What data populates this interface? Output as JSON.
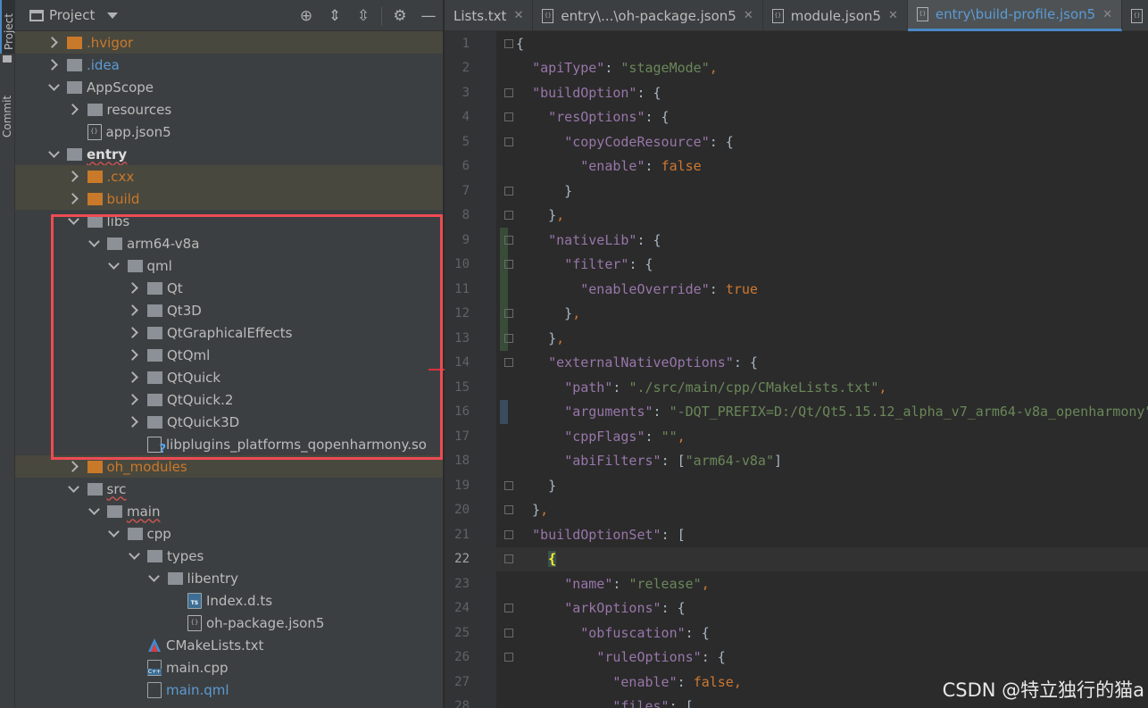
{
  "sidebar_strip": {
    "project_label": "Project",
    "commit_label": "Commit"
  },
  "project_panel": {
    "title": "Project",
    "tree": [
      {
        "label": ".hvigor",
        "icon": "folder-orange",
        "arrow": "collapsed",
        "indent": 0,
        "style": "orange",
        "excluded": true
      },
      {
        "label": ".idea",
        "icon": "folder",
        "arrow": "collapsed",
        "indent": 0,
        "style": "blue",
        "excluded": false
      },
      {
        "label": "AppScope",
        "icon": "folder",
        "arrow": "expanded",
        "indent": 0,
        "style": "",
        "excluded": false
      },
      {
        "label": "resources",
        "icon": "folder",
        "arrow": "collapsed",
        "indent": 1,
        "style": "",
        "excluded": false
      },
      {
        "label": "app.json5",
        "icon": "json-file",
        "arrow": "none",
        "indent": 1,
        "style": "",
        "excluded": false
      },
      {
        "label": "entry",
        "icon": "module-folder",
        "arrow": "expanded",
        "indent": 0,
        "style": "bold squiggle",
        "excluded": false
      },
      {
        "label": ".cxx",
        "icon": "folder-orange",
        "arrow": "collapsed",
        "indent": 1,
        "style": "orange",
        "excluded": true
      },
      {
        "label": "build",
        "icon": "folder-orange",
        "arrow": "collapsed",
        "indent": 1,
        "style": "orange",
        "excluded": true
      },
      {
        "label": "libs",
        "icon": "folder",
        "arrow": "expanded",
        "indent": 1,
        "style": "",
        "excluded": false
      },
      {
        "label": "arm64-v8a",
        "icon": "folder",
        "arrow": "expanded",
        "indent": 2,
        "style": "",
        "excluded": false
      },
      {
        "label": "qml",
        "icon": "folder",
        "arrow": "expanded",
        "indent": 3,
        "style": "",
        "excluded": false
      },
      {
        "label": "Qt",
        "icon": "folder",
        "arrow": "collapsed",
        "indent": 4,
        "style": "",
        "excluded": false
      },
      {
        "label": "Qt3D",
        "icon": "folder",
        "arrow": "collapsed",
        "indent": 4,
        "style": "",
        "excluded": false
      },
      {
        "label": "QtGraphicalEffects",
        "icon": "folder",
        "arrow": "collapsed",
        "indent": 4,
        "style": "",
        "excluded": false
      },
      {
        "label": "QtQml",
        "icon": "folder",
        "arrow": "collapsed",
        "indent": 4,
        "style": "",
        "excluded": false
      },
      {
        "label": "QtQuick",
        "icon": "folder",
        "arrow": "collapsed",
        "indent": 4,
        "style": "",
        "excluded": false
      },
      {
        "label": "QtQuick.2",
        "icon": "folder",
        "arrow": "collapsed",
        "indent": 4,
        "style": "",
        "excluded": false
      },
      {
        "label": "QtQuick3D",
        "icon": "folder",
        "arrow": "collapsed",
        "indent": 4,
        "style": "",
        "excluded": false
      },
      {
        "label": "libplugins_platforms_qopenharmony.so",
        "icon": "unknown-file",
        "arrow": "none",
        "indent": 4,
        "style": "",
        "excluded": false
      },
      {
        "label": "oh_modules",
        "icon": "folder-orange",
        "arrow": "collapsed",
        "indent": 1,
        "style": "orange",
        "excluded": true
      },
      {
        "label": "src",
        "icon": "folder",
        "arrow": "expanded",
        "indent": 1,
        "style": "squiggle",
        "excluded": false
      },
      {
        "label": "main",
        "icon": "folder",
        "arrow": "expanded",
        "indent": 2,
        "style": "squiggle",
        "excluded": false
      },
      {
        "label": "cpp",
        "icon": "folder",
        "arrow": "expanded",
        "indent": 3,
        "style": "",
        "excluded": false
      },
      {
        "label": "types",
        "icon": "folder",
        "arrow": "expanded",
        "indent": 4,
        "style": "",
        "excluded": false
      },
      {
        "label": "libentry",
        "icon": "folder",
        "arrow": "expanded",
        "indent": 5,
        "style": "",
        "excluded": false
      },
      {
        "label": "Index.d.ts",
        "icon": "ts-file",
        "arrow": "none",
        "indent": 6,
        "style": "",
        "excluded": false
      },
      {
        "label": "oh-package.json5",
        "icon": "json-file",
        "arrow": "none",
        "indent": 6,
        "style": "",
        "excluded": false
      },
      {
        "label": "CMakeLists.txt",
        "icon": "cmake-file",
        "arrow": "none",
        "indent": 4,
        "style": "",
        "excluded": false
      },
      {
        "label": "main.cpp",
        "icon": "cpp-file",
        "arrow": "none",
        "indent": 4,
        "style": "",
        "excluded": false
      },
      {
        "label": "main.qml",
        "icon": "qml-file",
        "arrow": "none",
        "indent": 4,
        "style": "blue",
        "excluded": false
      }
    ]
  },
  "editor": {
    "tabs": [
      {
        "label": "Lists.txt",
        "icon": false,
        "active": false
      },
      {
        "label": "entry\\...\\oh-package.json5",
        "icon": true,
        "active": false
      },
      {
        "label": "module.json5",
        "icon": true,
        "active": false
      },
      {
        "label": "entry\\build-profile.json5",
        "icon": true,
        "active": true
      },
      {
        "label": "b",
        "icon": true,
        "active": false
      }
    ],
    "current_line": 22,
    "lines": [
      {
        "n": 1,
        "tokens": [
          [
            "p",
            "{"
          ]
        ]
      },
      {
        "n": 2,
        "tokens": [
          [
            "p",
            "  "
          ],
          [
            "k",
            "\"apiType\""
          ],
          [
            "p",
            ": "
          ],
          [
            "s",
            "\"stageMode\""
          ],
          [
            "b",
            ","
          ]
        ]
      },
      {
        "n": 3,
        "tokens": [
          [
            "p",
            "  "
          ],
          [
            "k",
            "\"buildOption\""
          ],
          [
            "p",
            ": {"
          ]
        ]
      },
      {
        "n": 4,
        "tokens": [
          [
            "p",
            "    "
          ],
          [
            "k",
            "\"resOptions\""
          ],
          [
            "p",
            ": {"
          ]
        ]
      },
      {
        "n": 5,
        "tokens": [
          [
            "p",
            "      "
          ],
          [
            "k",
            "\"copyCodeResource\""
          ],
          [
            "p",
            ": {"
          ]
        ]
      },
      {
        "n": 6,
        "tokens": [
          [
            "p",
            "        "
          ],
          [
            "k",
            "\"enable\""
          ],
          [
            "p",
            ": "
          ],
          [
            "b",
            "false"
          ]
        ]
      },
      {
        "n": 7,
        "tokens": [
          [
            "p",
            "      }"
          ]
        ]
      },
      {
        "n": 8,
        "tokens": [
          [
            "p",
            "    }"
          ],
          [
            "b",
            ","
          ]
        ]
      },
      {
        "n": 9,
        "tokens": [
          [
            "p",
            "    "
          ],
          [
            "k",
            "\"nativeLib\""
          ],
          [
            "p",
            ": {"
          ]
        ]
      },
      {
        "n": 10,
        "tokens": [
          [
            "p",
            "      "
          ],
          [
            "k",
            "\"filter\""
          ],
          [
            "p",
            ": {"
          ]
        ]
      },
      {
        "n": 11,
        "tokens": [
          [
            "p",
            "        "
          ],
          [
            "k",
            "\"enableOverride\""
          ],
          [
            "p",
            ": "
          ],
          [
            "b",
            "true"
          ]
        ]
      },
      {
        "n": 12,
        "tokens": [
          [
            "p",
            "      }"
          ],
          [
            "b",
            ","
          ]
        ]
      },
      {
        "n": 13,
        "tokens": [
          [
            "p",
            "    }"
          ],
          [
            "b",
            ","
          ]
        ]
      },
      {
        "n": 14,
        "tokens": [
          [
            "p",
            "    "
          ],
          [
            "k",
            "\"externalNativeOptions\""
          ],
          [
            "p",
            ": {"
          ]
        ]
      },
      {
        "n": 15,
        "tokens": [
          [
            "p",
            "      "
          ],
          [
            "k",
            "\"path\""
          ],
          [
            "p",
            ": "
          ],
          [
            "s",
            "\"./src/main/cpp/CMakeLists.txt\""
          ],
          [
            "b",
            ","
          ]
        ]
      },
      {
        "n": 16,
        "tokens": [
          [
            "p",
            "      "
          ],
          [
            "k",
            "\"arguments\""
          ],
          [
            "p",
            ": "
          ],
          [
            "s",
            "\"-DQT_PREFIX=D:/Qt/Qt5.15.12_alpha_v7_arm64-v8a_openharmony\""
          ]
        ]
      },
      {
        "n": 17,
        "tokens": [
          [
            "p",
            "      "
          ],
          [
            "k",
            "\"cppFlags\""
          ],
          [
            "p",
            ": "
          ],
          [
            "s",
            "\"\""
          ],
          [
            "b",
            ","
          ]
        ]
      },
      {
        "n": 18,
        "tokens": [
          [
            "p",
            "      "
          ],
          [
            "k",
            "\"abiFilters\""
          ],
          [
            "p",
            ": ["
          ],
          [
            "s",
            "\"arm64-v8a\""
          ],
          [
            "p",
            "]"
          ]
        ]
      },
      {
        "n": 19,
        "tokens": [
          [
            "p",
            "    }"
          ]
        ]
      },
      {
        "n": 20,
        "tokens": [
          [
            "p",
            "  }"
          ],
          [
            "b",
            ","
          ]
        ]
      },
      {
        "n": 21,
        "tokens": [
          [
            "p",
            "  "
          ],
          [
            "k",
            "\"buildOptionSet\""
          ],
          [
            "p",
            ": ["
          ]
        ]
      },
      {
        "n": 22,
        "tokens": [
          [
            "p",
            "    "
          ],
          [
            "h",
            "{"
          ]
        ]
      },
      {
        "n": 23,
        "tokens": [
          [
            "p",
            "      "
          ],
          [
            "k",
            "\"name\""
          ],
          [
            "p",
            ": "
          ],
          [
            "s",
            "\"release\""
          ],
          [
            "b",
            ","
          ]
        ]
      },
      {
        "n": 24,
        "tokens": [
          [
            "p",
            "      "
          ],
          [
            "k",
            "\"arkOptions\""
          ],
          [
            "p",
            ": {"
          ]
        ]
      },
      {
        "n": 25,
        "tokens": [
          [
            "p",
            "        "
          ],
          [
            "k",
            "\"obfuscation\""
          ],
          [
            "p",
            ": {"
          ]
        ]
      },
      {
        "n": 26,
        "tokens": [
          [
            "p",
            "          "
          ],
          [
            "k",
            "\"ruleOptions\""
          ],
          [
            "p",
            ": {"
          ]
        ]
      },
      {
        "n": 27,
        "tokens": [
          [
            "p",
            "            "
          ],
          [
            "k",
            "\"enable\""
          ],
          [
            "p",
            ": "
          ],
          [
            "b",
            "false,"
          ]
        ]
      },
      {
        "n": 28,
        "tokens": [
          [
            "p",
            "            "
          ],
          [
            "k",
            "\"files\""
          ],
          [
            "p",
            ": ["
          ]
        ]
      }
    ]
  },
  "watermark": "CSDN @特立独行的猫a"
}
